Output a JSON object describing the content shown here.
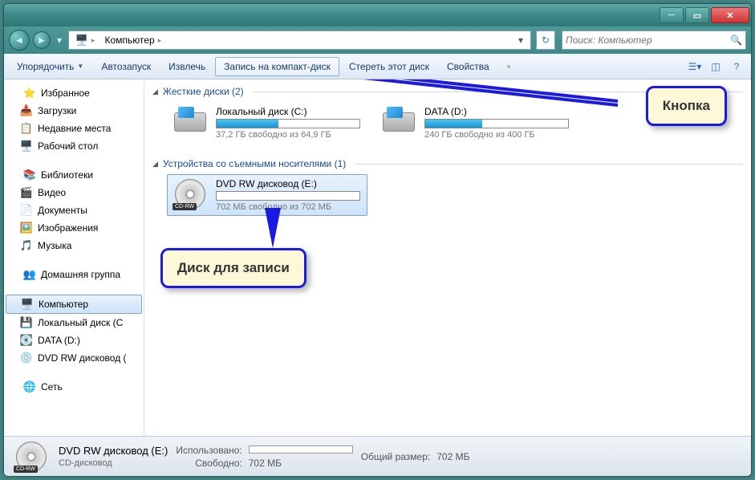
{
  "nav": {
    "location": "Компьютер",
    "search_placeholder": "Поиск: Компьютер"
  },
  "toolbar": {
    "organize": "Упорядочить",
    "autoplay": "Автозапуск",
    "eject": "Извлечь",
    "burn": "Запись на компакт-диск",
    "erase": "Стереть этот диск",
    "properties": "Свойства"
  },
  "sidebar": {
    "favorites": {
      "label": "Избранное",
      "items": [
        "Загрузки",
        "Недавние места",
        "Рабочий стол"
      ]
    },
    "libraries": {
      "label": "Библиотеки",
      "items": [
        "Видео",
        "Документы",
        "Изображения",
        "Музыка"
      ]
    },
    "homegroup": {
      "label": "Домашняя группа"
    },
    "computer": {
      "label": "Компьютер",
      "items": [
        "Локальный диск (C",
        "DATA (D:)",
        "DVD RW дисковод ("
      ]
    },
    "network": {
      "label": "Сеть"
    }
  },
  "main": {
    "hdd": {
      "label": "Жесткие диски (2)",
      "drives": [
        {
          "name": "Локальный диск (C:)",
          "free": "37,2 ГБ свободно из 64,9 ГБ",
          "pct": 43
        },
        {
          "name": "DATA (D:)",
          "free": "240 ГБ свободно из 400 ГБ",
          "pct": 40
        }
      ]
    },
    "removable": {
      "label": "Устройства со съемными носителями (1)",
      "drives": [
        {
          "name": "DVD RW дисковод (E:)",
          "free": "702 МБ свободно из 702 МБ",
          "pct": 0,
          "badge": "CD-RW"
        }
      ]
    }
  },
  "callouts": {
    "button": "Кнопка",
    "disc": "Диск для записи"
  },
  "status": {
    "title": "DVD RW дисковод (E:)",
    "sub": "CD-дисковод",
    "used_lbl": "Использовано:",
    "total_lbl": "Общий размер:",
    "total": "702 МБ",
    "free_lbl": "Свободно:",
    "free": "702 МБ",
    "badge": "CD-RW"
  }
}
